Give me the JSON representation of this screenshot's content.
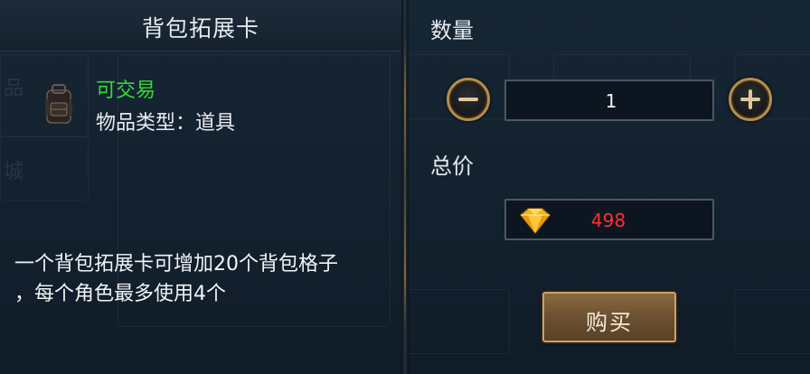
{
  "left": {
    "title": "背包拓展卡",
    "item": {
      "icon": "backpack-icon",
      "tradeable_text": "可交易",
      "type_text": "物品类型：道具"
    },
    "description": {
      "line1": "一个背包拓展卡可增加20个背包格子",
      "line2": "，每个角色最多使用4个"
    }
  },
  "right": {
    "quantity_label": "数量",
    "quantity_value": "1",
    "minus_icon": "minus-icon",
    "plus_icon": "plus-icon",
    "total_label": "总价",
    "total_price": "498",
    "currency_icon": "gold-gem-icon",
    "buy_label": "购买"
  },
  "colors": {
    "tradeable": "#38d838",
    "price": "#ff3030",
    "button_gold": "#c7a46a"
  }
}
